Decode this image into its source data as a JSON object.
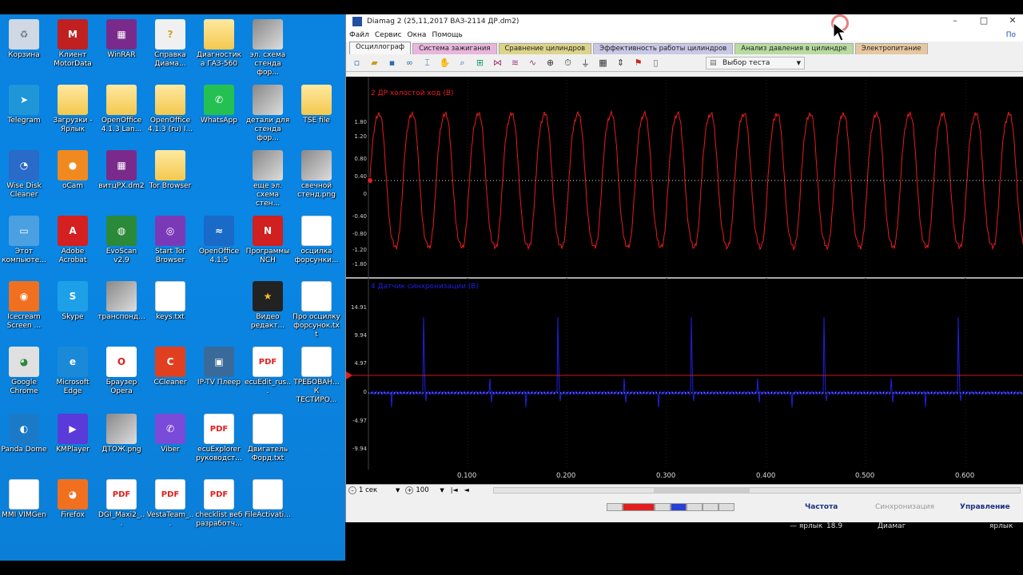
{
  "desktop": {
    "icons": [
      {
        "label": "Корзина",
        "icon": "recycle-bin-icon"
      },
      {
        "label": "Клиент MotorData",
        "icon": "motordata-icon"
      },
      {
        "label": "WinRAR",
        "icon": "winrar-icon"
      },
      {
        "label": "Справка Диама...",
        "icon": "help-icon"
      },
      {
        "label": "Диагностика ГАЗ-560",
        "icon": "folder-icon"
      },
      {
        "label": "эл. схема стенда фор...",
        "icon": "image-icon"
      },
      {
        "label": "Telegram",
        "icon": "telegram-icon"
      },
      {
        "label": "Загрузки - Ярлык",
        "icon": "folder-icon"
      },
      {
        "label": "OpenOffice 4.1.3 Lan...",
        "icon": "folder-icon"
      },
      {
        "label": "OpenOffice 4.1.3 (ru) I...",
        "icon": "folder-icon"
      },
      {
        "label": "WhatsApp",
        "icon": "whatsapp-icon"
      },
      {
        "label": "детали для стенда фор...",
        "icon": "image-icon"
      },
      {
        "label": "TSE file",
        "icon": "folder-icon"
      },
      {
        "label": "Wise Disk Cleaner",
        "icon": "wise-disk-icon"
      },
      {
        "label": "oCam",
        "icon": "ocam-icon"
      },
      {
        "label": "витцРХ.dm2",
        "icon": "winrar-icon"
      },
      {
        "label": "Tor Browser",
        "icon": "folder-icon"
      },
      {
        "label": "еще эл. схема стен...",
        "icon": "image-icon"
      },
      {
        "label": "свечной стенд.png",
        "icon": "image-icon"
      },
      {
        "label": "Этот компьюте...",
        "icon": "computer-icon"
      },
      {
        "label": "Adobe Acrobat",
        "icon": "acrobat-icon"
      },
      {
        "label": "EvoScan v2.9",
        "icon": "evoscan-icon"
      },
      {
        "label": "Start Tor Browser",
        "icon": "tor-icon"
      },
      {
        "label": "OpenOffice 4.1.5",
        "icon": "openoffice-icon"
      },
      {
        "label": "Программы NCH",
        "icon": "nch-icon"
      },
      {
        "label": "осцилка форсунки...",
        "icon": "document-icon"
      },
      {
        "label": "Icecream Screen ...",
        "icon": "icecream-icon"
      },
      {
        "label": "Skype",
        "icon": "skype-icon"
      },
      {
        "label": "транспонд...",
        "icon": "image-icon"
      },
      {
        "label": "keys.txt",
        "icon": "document-icon"
      },
      {
        "label": "Видео редакт...",
        "icon": "video-editor-icon"
      },
      {
        "label": "Про осцилку форсунок.txt",
        "icon": "document-icon"
      },
      {
        "label": "Google Chrome",
        "icon": "chrome-icon"
      },
      {
        "label": "Microsoft Edge",
        "icon": "edge-icon"
      },
      {
        "label": "Браузер Opera",
        "icon": "opera-icon"
      },
      {
        "label": "CCleaner",
        "icon": "ccleaner-icon"
      },
      {
        "label": "IP-TV Плеер",
        "icon": "iptv-icon"
      },
      {
        "label": "ecuEdit_rus...",
        "icon": "pdf-icon"
      },
      {
        "label": "ТРЕБОВАН... К ТЕСТИРО...",
        "icon": "document-icon"
      },
      {
        "label": "Panda Dome",
        "icon": "panda-icon"
      },
      {
        "label": "KMPlayer",
        "icon": "kmplayer-icon"
      },
      {
        "label": "ДТОЖ.png",
        "icon": "image-icon"
      },
      {
        "label": "Viber",
        "icon": "viber-icon"
      },
      {
        "label": "ecuExplorer руководст...",
        "icon": "pdf-icon"
      },
      {
        "label": "Двигатель Форд.txt",
        "icon": "document-icon"
      },
      {
        "label": "MMI VIMGen",
        "icon": "document-icon"
      },
      {
        "label": "Firefox",
        "icon": "firefox-icon"
      },
      {
        "label": "DGI_Maxi2_...",
        "icon": "pdf-icon"
      },
      {
        "label": "VestaTeam_...",
        "icon": "pdf-icon"
      },
      {
        "label": "checklist веб разработч...",
        "icon": "pdf-icon"
      },
      {
        "label": "FileActivati...",
        "icon": "document-icon"
      }
    ]
  },
  "window": {
    "title": "Diamag 2 (25,11,2017 ВАЗ-2114 ДР.dm2)",
    "minimize": "–",
    "maximize": "□",
    "close": "✕",
    "menu": [
      "Файл",
      "Сервис",
      "Окна",
      "Помощь"
    ],
    "menu_right": "По",
    "tabs": [
      {
        "label": "Осциллограф",
        "color": "#f7f7f7"
      },
      {
        "label": "Система зажигания",
        "color": "#e8b6dc"
      },
      {
        "label": "Сравнение цилиндров",
        "color": "#dcd48a"
      },
      {
        "label": "Эффективность работы цилиндров",
        "color": "#c8c8e6"
      },
      {
        "label": "Анализ давления в цилиндре",
        "color": "#b8dca0"
      },
      {
        "label": "Электропитание",
        "color": "#e6c8a0"
      }
    ],
    "test_select": "Выбор теста"
  },
  "plots": {
    "top": {
      "title": "2 ДР холостой ход (В)",
      "color": "#e81c1c",
      "yticks": [
        "1.80",
        "1.20",
        "0.80",
        "0.40",
        "0",
        "-0.40",
        "-0.80",
        "-1.20",
        "-1.80"
      ]
    },
    "bottom": {
      "title": "4 Датчик синхронизации (В)",
      "color": "#2020e0",
      "yticks": [
        "14.91",
        "9.94",
        "4.97",
        "0",
        "-4.97",
        "-9.94"
      ]
    },
    "xticks": [
      "0.100",
      "0.200",
      "0.300",
      "0.400",
      "0.500",
      "0.600"
    ]
  },
  "bottombar": {
    "timebase": "1 сек",
    "zoom": "100",
    "first": "|◄",
    "prev": "◄"
  },
  "navbar": {
    "freq": "Частота",
    "sync": "Синхронизация",
    "control": "Управление"
  },
  "status": {
    "shortcut": "— ярлык",
    "value": "18.9",
    "app": "Диамаг",
    "shortcut2": "ярлык"
  }
}
